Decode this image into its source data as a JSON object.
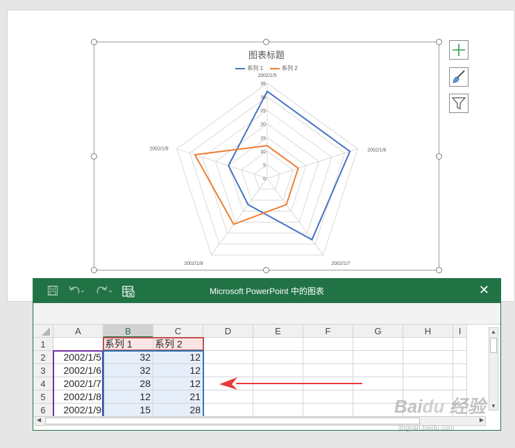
{
  "chart": {
    "title": "图表标题",
    "legend": [
      {
        "name": "系列 1",
        "color": "#4472c4"
      },
      {
        "name": "系列 2",
        "color": "#ed7d31"
      }
    ]
  },
  "chart_data": {
    "type": "radar",
    "title": "图表标题",
    "categories": [
      "2002/1/5",
      "2002/1/6",
      "2002/1/7",
      "2002/1/8",
      "2002/1/9"
    ],
    "series": [
      {
        "name": "系列 1",
        "values": [
          32,
          32,
          28,
          12,
          15
        ],
        "color": "#4472c4"
      },
      {
        "name": "系列 2",
        "values": [
          12,
          12,
          12,
          21,
          28
        ],
        "color": "#ed7d31"
      }
    ],
    "rlim": [
      0,
      35
    ],
    "ticks": [
      "0",
      "5",
      "10",
      "15",
      "20",
      "25",
      "30",
      "35"
    ],
    "legend": "top"
  },
  "side_buttons": {
    "add": "chart-elements",
    "style": "chart-styles",
    "filter": "chart-filters"
  },
  "excel": {
    "title": "Microsoft PowerPoint 中的图表",
    "close": "✕",
    "columns": [
      "A",
      "B",
      "C",
      "D",
      "E",
      "F",
      "G",
      "H",
      "I"
    ],
    "rows": [
      {
        "num": "1",
        "a": "",
        "b": "系列 1",
        "c": "系列 2"
      },
      {
        "num": "2",
        "a": "2002/1/5",
        "b": "32",
        "c": "12"
      },
      {
        "num": "3",
        "a": "2002/1/6",
        "b": "32",
        "c": "12"
      },
      {
        "num": "4",
        "a": "2002/1/7",
        "b": "28",
        "c": "12"
      },
      {
        "num": "5",
        "a": "2002/1/8",
        "b": "12",
        "c": "21"
      },
      {
        "num": "6",
        "a": "2002/1/9",
        "b": "15",
        "c": "28"
      }
    ]
  },
  "annotation": {
    "arrow_color": "#e83a3a"
  },
  "watermark": {
    "text": "Baidu 经验",
    "sub": "jingyan.baidu.com"
  }
}
